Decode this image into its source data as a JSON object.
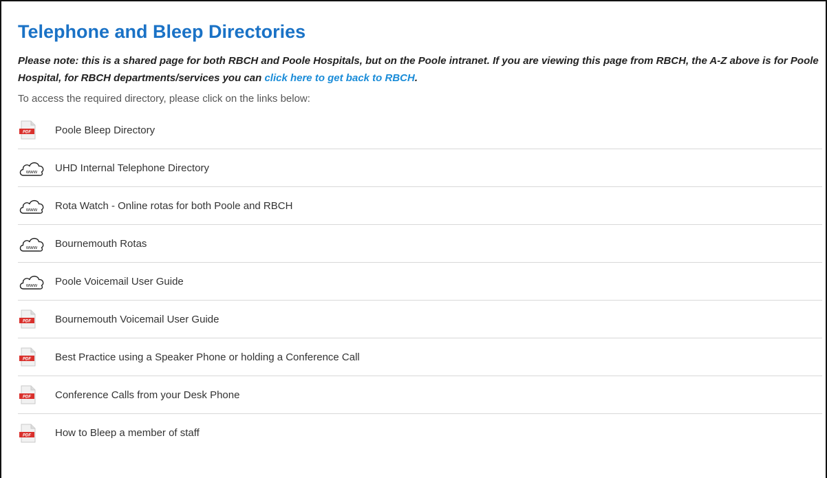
{
  "page": {
    "title": "Telephone and Bleep Directories",
    "note": {
      "text": "Please note: this is a shared page for both RBCH and Poole Hospitals, but on the Poole intranet. If you are viewing this page from RBCH, the A-Z above is for Poole Hospital, for RBCH departments/services you can ",
      "link_text": "click here to get back to RBCH",
      "suffix": "."
    },
    "intro": "To access the required directory, please click on the links below:"
  },
  "links": [
    {
      "label": "Poole Bleep Directory",
      "icon": "pdf-icon"
    },
    {
      "label": "UHD Internal Telephone Directory",
      "icon": "www-cloud-icon"
    },
    {
      "label": "Rota Watch - Online rotas for both Poole and RBCH",
      "icon": "www-cloud-icon"
    },
    {
      "label": "Bournemouth Rotas",
      "icon": "www-cloud-icon"
    },
    {
      "label": "Poole Voicemail User Guide",
      "icon": "www-cloud-icon"
    },
    {
      "label": "Bournemouth Voicemail User Guide",
      "icon": "pdf-icon"
    },
    {
      "label": "Best Practice using a Speaker Phone or holding a Conference Call",
      "icon": "pdf-icon"
    },
    {
      "label": "Conference Calls from your Desk Phone",
      "icon": "pdf-icon"
    },
    {
      "label": "How to Bleep a member of staff",
      "icon": "pdf-icon"
    }
  ],
  "icons": {
    "pdf_badge_text": "PDF",
    "www_text": "www"
  },
  "colors": {
    "title": "#1a72c6",
    "link": "#1a8cd8",
    "pdf_red": "#d9302c"
  }
}
